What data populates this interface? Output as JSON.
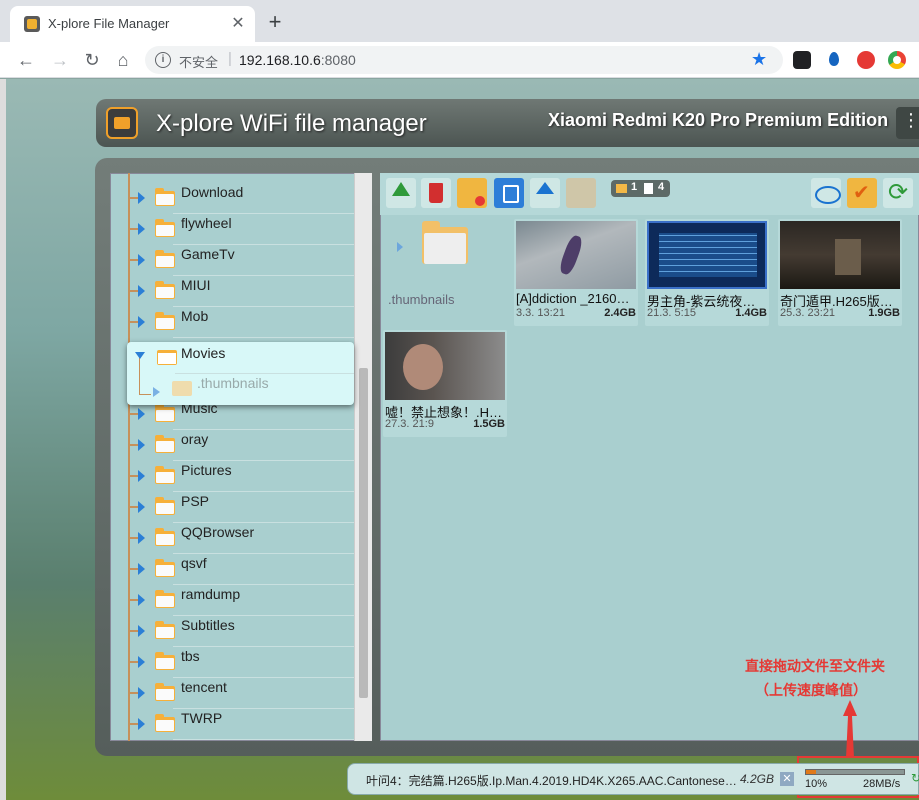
{
  "browser": {
    "tab_title": "X-plore File Manager",
    "tab_close": "✕",
    "new_tab": "+",
    "insecure_label": "不安全",
    "url_separator": "|",
    "url_host": "192.168.10.6",
    "url_port": ":8080",
    "back": "←",
    "forward": "→",
    "reload": "↻",
    "home": "⌂",
    "info": "i",
    "star": "★",
    "extension_icons": [
      "extension-icon",
      "drop-icon",
      "shield-icon",
      "chrome-icon"
    ]
  },
  "app": {
    "title": "X-plore WiFi file manager",
    "device": "Xiaomi Redmi K20 Pro Premium Edition"
  },
  "tree": {
    "items": [
      {
        "label": "Download"
      },
      {
        "label": "flywheel"
      },
      {
        "label": "GameTv"
      },
      {
        "label": "MIUI"
      },
      {
        "label": "Mob"
      },
      {
        "label": "Music"
      },
      {
        "label": "oray"
      },
      {
        "label": "Pictures"
      },
      {
        "label": "PSP"
      },
      {
        "label": "QQBrowser"
      },
      {
        "label": "qsvf"
      },
      {
        "label": "ramdump"
      },
      {
        "label": "Subtitles"
      },
      {
        "label": "tbs"
      },
      {
        "label": "tencent"
      },
      {
        "label": "TWRP"
      }
    ],
    "selected": {
      "label": "Movies",
      "child": ".thumbnails"
    }
  },
  "toolbar": {
    "counter": {
      "folders": "1",
      "files": "4"
    },
    "icons": [
      "up-icon",
      "delete-icon",
      "new-folder-icon",
      "rename-icon",
      "upload-icon",
      "download-icon",
      "view-icon",
      "select-icon",
      "refresh-icon"
    ]
  },
  "files": {
    "directory": {
      "name": ".thumbnails"
    },
    "items": [
      {
        "name": "[A]ddiction _2160…",
        "date": "3.3. 13:21",
        "size": "2.4GB"
      },
      {
        "name": "男主角-紫云统夜…",
        "date": "21.3. 5:15",
        "size": "1.4GB"
      },
      {
        "name": "奇门遁甲.H265版…",
        "date": "25.3. 23:21",
        "size": "1.9GB"
      },
      {
        "name": "嘘！禁止想象！.H…",
        "date": "27.3. 21:9",
        "size": "1.5GB"
      }
    ]
  },
  "annotation": {
    "line1": "直接拖动文件至文件夹",
    "line2": "（上传速度峰值）",
    "color": "#e53935"
  },
  "status": {
    "file": "叶问4：完结篇.H265版.Ip.Man.4.2019.HD4K.X265.AAC.Cantonese…",
    "size": "4.2GB",
    "cancel": "✕",
    "progress_percent": 10,
    "progress_label": "10%",
    "speed": "28MB/s",
    "refresh": "↻"
  }
}
